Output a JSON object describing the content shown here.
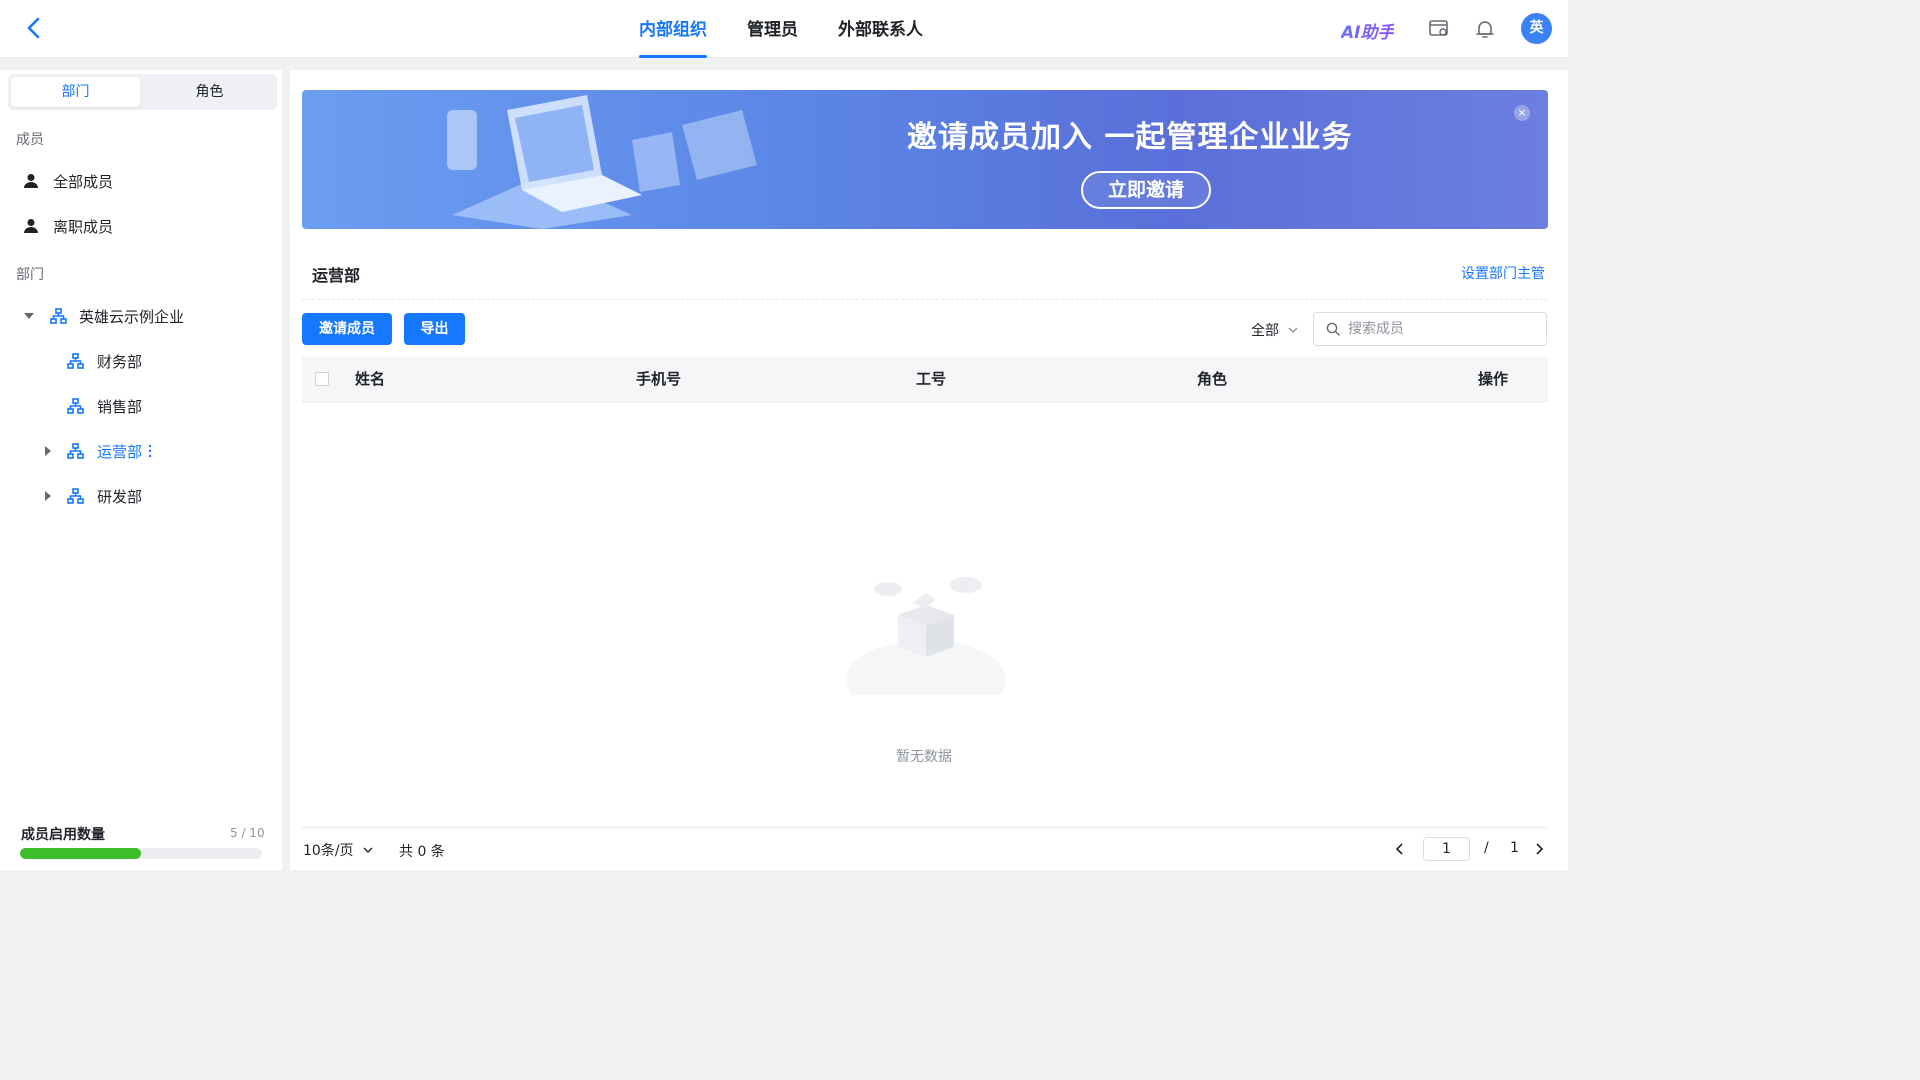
{
  "header": {
    "tabs": [
      {
        "label": "内部组织",
        "active": true
      },
      {
        "label": "管理员",
        "active": false
      },
      {
        "label": "外部联系人",
        "active": false
      }
    ],
    "ai_helper": "AI助手",
    "avatar_text": "英"
  },
  "sidebar": {
    "segments": [
      "部门",
      "角色"
    ],
    "active_segment": "部门",
    "members_title": "成员",
    "members_items": [
      "全部成员",
      "离职成员"
    ],
    "departments_title": "部门",
    "tree": {
      "root": "英雄云示例企业",
      "children": [
        "财务部",
        "销售部",
        "运营部",
        "研发部"
      ]
    },
    "quota": {
      "label": "成员启用数量",
      "count": "5 / 10",
      "used": 5,
      "total": 10
    }
  },
  "banner": {
    "title": "邀请成员加入 一起管理企业业务",
    "button": "立即邀请",
    "close": "×"
  },
  "content": {
    "department_name": "运营部",
    "set_manager": "设置部门主管",
    "invite_button": "邀请成员",
    "export_button": "导出",
    "filter_value": "全部",
    "search_placeholder": "搜索成员",
    "columns": [
      "姓名",
      "手机号",
      "工号",
      "角色",
      "操作"
    ],
    "rows": [],
    "empty_text": "暂无数据"
  },
  "pagination": {
    "page_size": "10条/页",
    "total": "共 0 条",
    "current_page": "1",
    "separator": "/",
    "total_pages": "1"
  },
  "colors": {
    "accent": "#1677ff",
    "progress": "#3cbd2a"
  }
}
